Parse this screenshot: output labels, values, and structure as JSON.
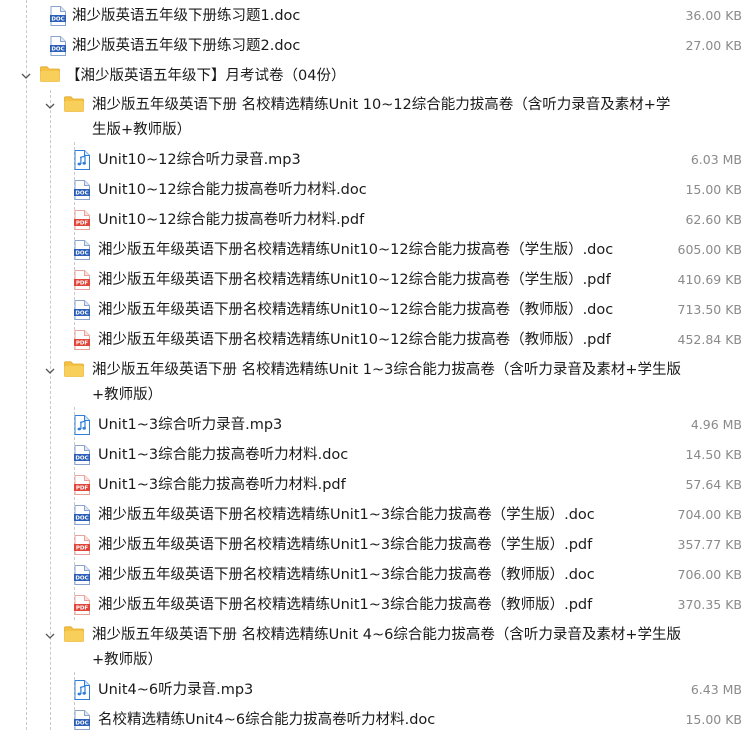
{
  "top_files": [
    {
      "name": "湘少版英语五年级下册练习题1.doc",
      "size": "36.00 KB",
      "type": "doc"
    },
    {
      "name": "湘少版英语五年级下册练习题2.doc",
      "size": "27.00 KB",
      "type": "doc"
    }
  ],
  "root_folder": {
    "name": "【湘少版英语五年级下】月考试卷（04份）"
  },
  "folder1": {
    "name": "湘少版五年级英语下册 名校精选精练Unit 10~12综合能力拔高卷（含听力录音及素材+学生版+教师版）",
    "files": [
      {
        "name": "Unit10~12综合听力录音.mp3",
        "size": "6.03 MB",
        "type": "mp3"
      },
      {
        "name": "Unit10~12综合能力拔高卷听力材料.doc",
        "size": "15.00 KB",
        "type": "doc"
      },
      {
        "name": "Unit10~12综合能力拔高卷听力材料.pdf",
        "size": "62.60 KB",
        "type": "pdf"
      },
      {
        "name": "湘少版五年级英语下册名校精选精练Unit10~12综合能力拔高卷（学生版）.doc",
        "size": "605.00 KB",
        "type": "doc"
      },
      {
        "name": "湘少版五年级英语下册名校精选精练Unit10~12综合能力拔高卷（学生版）.pdf",
        "size": "410.69 KB",
        "type": "pdf"
      },
      {
        "name": "湘少版五年级英语下册名校精选精练Unit10~12综合能力拔高卷（教师版）.doc",
        "size": "713.50 KB",
        "type": "doc"
      },
      {
        "name": "湘少版五年级英语下册名校精选精练Unit10~12综合能力拔高卷（教师版）.pdf",
        "size": "452.84 KB",
        "type": "pdf"
      }
    ]
  },
  "folder2": {
    "name": "湘少版五年级英语下册 名校精选精练Unit 1~3综合能力拔高卷（含听力录音及素材+学生版+教师版）",
    "files": [
      {
        "name": "Unit1~3综合听力录音.mp3",
        "size": "4.96 MB",
        "type": "mp3"
      },
      {
        "name": "Unit1~3综合能力拔高卷听力材料.doc",
        "size": "14.50 KB",
        "type": "doc"
      },
      {
        "name": "Unit1~3综合能力拔高卷听力材料.pdf",
        "size": "57.64 KB",
        "type": "pdf"
      },
      {
        "name": "湘少版五年级英语下册名校精选精练Unit1~3综合能力拔高卷（学生版）.doc",
        "size": "704.00 KB",
        "type": "doc"
      },
      {
        "name": "湘少版五年级英语下册名校精选精练Unit1~3综合能力拔高卷（学生版）.pdf",
        "size": "357.77 KB",
        "type": "pdf"
      },
      {
        "name": "湘少版五年级英语下册名校精选精练Unit1~3综合能力拔高卷（教师版）.doc",
        "size": "706.00 KB",
        "type": "doc"
      },
      {
        "name": "湘少版五年级英语下册名校精选精练Unit1~3综合能力拔高卷（教师版）.pdf",
        "size": "370.35 KB",
        "type": "pdf"
      }
    ]
  },
  "folder3": {
    "name": "湘少版五年级英语下册 名校精选精练Unit 4~6综合能力拔高卷（含听力录音及素材+学生版+教师版）",
    "files": [
      {
        "name": "Unit4~6听力录音.mp3",
        "size": "6.43 MB",
        "type": "mp3"
      },
      {
        "name": "名校精选精练Unit4~6综合能力拔高卷听力材料.doc",
        "size": "15.00 KB",
        "type": "doc"
      }
    ]
  },
  "icon_labels": {
    "doc": "DOC",
    "pdf": "PDF"
  },
  "colors": {
    "doc_icon": "#2b5eb8",
    "pdf_icon": "#e0453a",
    "mp3_icon": "#2f7fd8",
    "folder_icon": "#f6c245",
    "size_text": "#8a8a8a",
    "guide_line": "#c9c9c9"
  }
}
